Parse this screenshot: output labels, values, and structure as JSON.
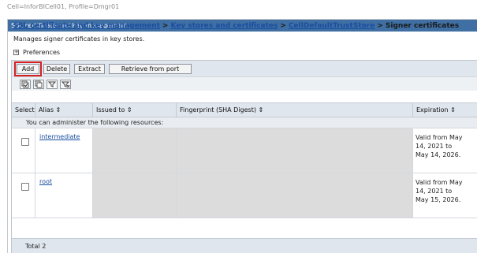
{
  "context": {
    "cell_profile": "Cell=InforBICell01, Profile=Dmgr01"
  },
  "panel": {
    "title": "SSL certificate and key management"
  },
  "breadcrumb": {
    "item1": "SSL certificate and key management",
    "item2": "Key stores and certificates",
    "item3": "CellDefaultTrustStore",
    "current": "Signer certificates",
    "separator": ">"
  },
  "description": "Manages signer certificates in key stores.",
  "preferences": {
    "label": "Preferences",
    "icon": "plus-box-icon"
  },
  "toolbar": {
    "add_label": "Add",
    "delete_label": "Delete",
    "extract_label": "Extract",
    "retrieve_label": "Retrieve from port"
  },
  "iconbar": {
    "select_all_icon": "select-all-icon",
    "deselect_all_icon": "deselect-all-icon",
    "show_filter_icon": "show-filter-icon",
    "clear_filter_icon": "clear-filter-icon"
  },
  "table": {
    "columns": {
      "select": "Select",
      "alias": "Alias",
      "issued_to": "Issued to",
      "fingerprint": "Fingerprint (SHA Digest)",
      "expiration": "Expiration"
    },
    "sort_glyph": "⇕",
    "admin_message": "You can administer the following resources:",
    "rows": [
      {
        "alias": "intermediate",
        "expiration": "Valid from May 14, 2021 to May 14, 2026."
      },
      {
        "alias": "root",
        "expiration": "Valid from May 14, 2021 to May 15, 2026."
      }
    ],
    "total": "Total 2"
  },
  "colors": {
    "header_blue": "#3f6fa3",
    "link": "#1a4ea0",
    "highlight_outline": "#d42020"
  }
}
